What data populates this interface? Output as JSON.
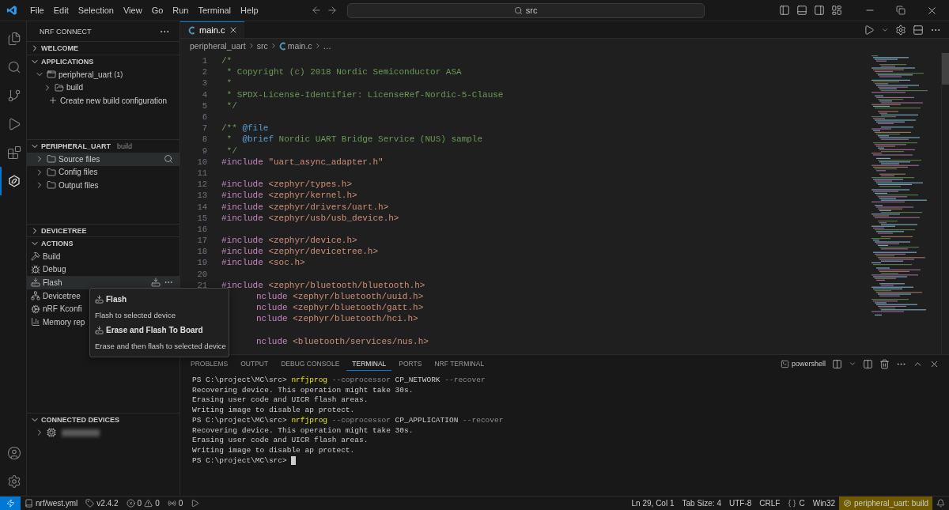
{
  "title_bar": {
    "menu": [
      "File",
      "Edit",
      "Selection",
      "View",
      "Go",
      "Run",
      "Terminal",
      "Help"
    ],
    "search": {
      "value": "src"
    }
  },
  "activity_bar": [
    {
      "kind": "explorer",
      "selected": false
    },
    {
      "kind": "search",
      "selected": false
    },
    {
      "kind": "source-control",
      "selected": false
    },
    {
      "kind": "run",
      "selected": false
    },
    {
      "kind": "extensions",
      "selected": false
    },
    {
      "kind": "nrf",
      "selected": true
    }
  ],
  "sidebar": {
    "title": "NRF CONNECT",
    "sections": [
      {
        "title": "WELCOME",
        "expanded": false
      },
      {
        "title": "APPLICATIONS",
        "expanded": true,
        "items": [
          {
            "label": "peripheral_uart",
            "count": "(1)",
            "kind": "app",
            "expanded": true,
            "hovered": false,
            "children": [
              {
                "label": "build",
                "kind": "build-folder",
                "expanded": false,
                "hovered": false
              }
            ]
          },
          {
            "label": "Create new build configuration",
            "kind": "create",
            "hovered": false
          }
        ]
      },
      {
        "title": "PERIPHERAL_UART",
        "subtitle": "build",
        "expanded": true,
        "items": [
          {
            "label": "Source files",
            "kind": "folder",
            "expanded": false,
            "hovered": true
          },
          {
            "label": "Config files",
            "kind": "folder",
            "expanded": false,
            "hovered": false
          },
          {
            "label": "Output files",
            "kind": "folder",
            "expanded": false,
            "hovered": false
          }
        ]
      },
      {
        "title": "DEVICETREE",
        "expanded": false
      },
      {
        "title": "ACTIONS",
        "expanded": true,
        "items": [
          {
            "label": "Build",
            "kind": "build",
            "hovered": false
          },
          {
            "label": "Debug",
            "kind": "debug",
            "hovered": false
          },
          {
            "label": "Flash",
            "kind": "flash",
            "hovered": true
          },
          {
            "label": "Devicetree",
            "kind": "devicetree",
            "hovered": false
          },
          {
            "label": "nRF Kconfi",
            "kind": "kconfig",
            "hovered": false
          },
          {
            "label": "Memory rep",
            "kind": "memory",
            "hovered": false
          }
        ]
      },
      {
        "title": "CONNECTED DEVICES",
        "expanded": true,
        "items": [
          {
            "kind": "device",
            "expanded": false,
            "hovered": false
          }
        ]
      }
    ]
  },
  "hover_menu": [
    {
      "title": "Flash",
      "description": "Flash to selected device"
    },
    {
      "title": "Erase and Flash To Board",
      "description": "Erase and then flash to selected device"
    }
  ],
  "editor": {
    "tabs": [
      {
        "label": "main.c",
        "selected": true
      }
    ],
    "breadcrumb": [
      "peripheral_uart",
      "src",
      "main.c",
      "…"
    ],
    "lines": [
      {
        "number": "1",
        "segments": [
          {
            "kind": "comment",
            "text": "/*"
          }
        ]
      },
      {
        "number": "2",
        "segments": [
          {
            "kind": "comment",
            "text": " * Copyright (c) 2018 Nordic Semiconductor ASA"
          }
        ]
      },
      {
        "number": "3",
        "segments": [
          {
            "kind": "comment",
            "text": " *"
          }
        ]
      },
      {
        "number": "4",
        "segments": [
          {
            "kind": "comment",
            "text": " * SPDX-License-Identifier: LicenseRef-Nordic-5-Clause"
          }
        ]
      },
      {
        "number": "5",
        "segments": [
          {
            "kind": "comment",
            "text": " */"
          }
        ]
      },
      {
        "number": "6"
      },
      {
        "number": "7",
        "segments": [
          {
            "kind": "comment",
            "text": "/** "
          },
          {
            "kind": "tag",
            "text": "@file"
          }
        ]
      },
      {
        "number": "8",
        "segments": [
          {
            "kind": "comment",
            "text": " *  "
          },
          {
            "kind": "tag",
            "text": "@brief"
          },
          {
            "kind": "comment",
            "text": " Nordic UART Bridge Service (NUS) sample"
          }
        ]
      },
      {
        "number": "9",
        "segments": [
          {
            "kind": "comment",
            "text": " */"
          }
        ]
      },
      {
        "number": "10",
        "segments": [
          {
            "kind": "keyword",
            "text": "#include"
          },
          {
            "kind": "string",
            "text": " \"uart_async_adapter.h\""
          }
        ]
      },
      {
        "number": "11"
      },
      {
        "number": "12",
        "segments": [
          {
            "kind": "keyword",
            "text": "#include"
          },
          {
            "kind": "string",
            "text": " <zephyr/types.h>"
          }
        ]
      },
      {
        "number": "13",
        "segments": [
          {
            "kind": "keyword",
            "text": "#include"
          },
          {
            "kind": "string",
            "text": " <zephyr/kernel.h>"
          }
        ]
      },
      {
        "number": "14",
        "segments": [
          {
            "kind": "keyword",
            "text": "#include"
          },
          {
            "kind": "string",
            "text": " <zephyr/drivers/uart.h>"
          }
        ]
      },
      {
        "number": "15",
        "segments": [
          {
            "kind": "keyword",
            "text": "#include"
          },
          {
            "kind": "string",
            "text": " <zephyr/usb/usb_device.h>"
          }
        ]
      },
      {
        "number": "16"
      },
      {
        "number": "17",
        "segments": [
          {
            "kind": "keyword",
            "text": "#include"
          },
          {
            "kind": "string",
            "text": " <zephyr/device.h>"
          }
        ]
      },
      {
        "number": "18",
        "segments": [
          {
            "kind": "keyword",
            "text": "#include"
          },
          {
            "kind": "string",
            "text": " <zephyr/devicetree.h>"
          }
        ]
      },
      {
        "number": "19",
        "segments": [
          {
            "kind": "keyword",
            "text": "#include"
          },
          {
            "kind": "string",
            "text": " <soc.h>"
          }
        ]
      },
      {
        "number": "20"
      },
      {
        "number": "21",
        "segments": [
          {
            "kind": "keyword",
            "text": "#include"
          },
          {
            "kind": "string",
            "text": " <zephyr/bluetooth/bluetooth.h>"
          }
        ]
      },
      {
        "covered": true,
        "segments": [
          {
            "kind": "keyword",
            "text": "nclude"
          },
          {
            "kind": "string",
            "text": " <zephyr/bluetooth/uuid.h>"
          }
        ]
      },
      {
        "covered": true,
        "segments": [
          {
            "kind": "keyword",
            "text": "nclude"
          },
          {
            "kind": "string",
            "text": " <zephyr/bluetooth/gatt.h>"
          }
        ]
      },
      {
        "covered": true,
        "segments": [
          {
            "kind": "keyword",
            "text": "nclude"
          },
          {
            "kind": "string",
            "text": " <zephyr/bluetooth/hci.h>"
          }
        ]
      },
      {
        "covered": true
      },
      {
        "covered": true,
        "segments": [
          {
            "kind": "keyword",
            "text": "nclude"
          },
          {
            "kind": "string",
            "text": " <bluetooth/services/nus.h>"
          }
        ]
      }
    ]
  },
  "panel": {
    "tabs": [
      {
        "label": "PROBLEMS",
        "selected": false
      },
      {
        "label": "OUTPUT",
        "selected": false
      },
      {
        "label": "DEBUG CONSOLE",
        "selected": false
      },
      {
        "label": "TERMINAL",
        "selected": true
      },
      {
        "label": "PORTS",
        "selected": false
      },
      {
        "label": "NRF TERMINAL",
        "selected": false
      }
    ],
    "shell": "powershell",
    "terminal": [
      [
        {
          "kind": "text",
          "text": "PS C:\\project\\MC\\src> "
        },
        {
          "kind": "command",
          "text": "nrfjprog"
        },
        {
          "kind": "flag",
          "text": " --coprocessor"
        },
        {
          "kind": "text",
          "text": " CP_NETWORK"
        },
        {
          "kind": "flag",
          "text": " --recover"
        }
      ],
      [
        {
          "kind": "text",
          "text": "Recovering device. This operation might take 30s."
        }
      ],
      [
        {
          "kind": "text",
          "text": "Erasing user code and UICR flash areas."
        }
      ],
      [
        {
          "kind": "text",
          "text": "Writing image to disable ap protect."
        }
      ],
      [
        {
          "kind": "text",
          "text": "PS C:\\project\\MC\\src> "
        },
        {
          "kind": "command",
          "text": "nrfjprog"
        },
        {
          "kind": "flag",
          "text": " --coprocessor"
        },
        {
          "kind": "text",
          "text": " CP_APPLICATION"
        },
        {
          "kind": "flag",
          "text": " --recover"
        }
      ],
      [
        {
          "kind": "text",
          "text": "Recovering device. This operation might take 30s."
        }
      ],
      [
        {
          "kind": "text",
          "text": "Erasing user code and UICR flash areas."
        }
      ],
      [
        {
          "kind": "text",
          "text": "Writing image to disable ap protect."
        }
      ],
      [
        {
          "kind": "text",
          "text": "PS C:\\project\\MC\\src> "
        },
        {
          "kind": "cursor"
        }
      ]
    ]
  },
  "status_bar": {
    "west_file": "nrf/west.yml",
    "sdk_version": "v2.4.2",
    "errors": "0",
    "warnings": "0",
    "ports": "0",
    "position": "Ln 29, Col 1",
    "tab_size": "Tab Size: 4",
    "encoding": "UTF-8",
    "eol": "CRLF",
    "language": "C",
    "platform": "Win32",
    "build_context": "peripheral_uart: build"
  }
}
